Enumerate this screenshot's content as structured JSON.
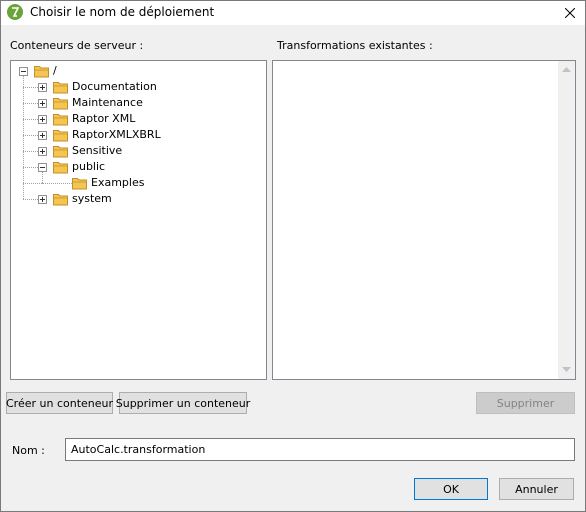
{
  "window": {
    "title": "Choisir le nom de déploiement"
  },
  "server_containers": {
    "label": "Conteneurs de serveur :",
    "tree": [
      {
        "label": "/",
        "expanded": true,
        "depth": 0
      },
      {
        "label": "Documentation",
        "expanded": false,
        "depth": 1
      },
      {
        "label": "Maintenance",
        "expanded": false,
        "depth": 1
      },
      {
        "label": "Raptor XML",
        "expanded": false,
        "depth": 1
      },
      {
        "label": "RaptorXMLXBRL",
        "expanded": false,
        "depth": 1
      },
      {
        "label": "Sensitive",
        "expanded": false,
        "depth": 1
      },
      {
        "label": "public",
        "expanded": true,
        "depth": 1
      },
      {
        "label": "Examples",
        "expanded": null,
        "depth": 2
      },
      {
        "label": "system",
        "expanded": false,
        "depth": 1
      }
    ]
  },
  "existing_transformations": {
    "label": "Transformations existantes :",
    "items": []
  },
  "buttons": {
    "create_container": "Créer un conteneur",
    "delete_container": "Supprimer un conteneur",
    "delete": "Supprimer",
    "ok": "OK",
    "cancel": "Annuler"
  },
  "name_field": {
    "label": "Nom :",
    "value": "AutoCalc.transformation"
  },
  "colors": {
    "folder_fill": "#f5c451",
    "folder_stroke": "#c0922c",
    "app_icon": "#6aa33a"
  }
}
